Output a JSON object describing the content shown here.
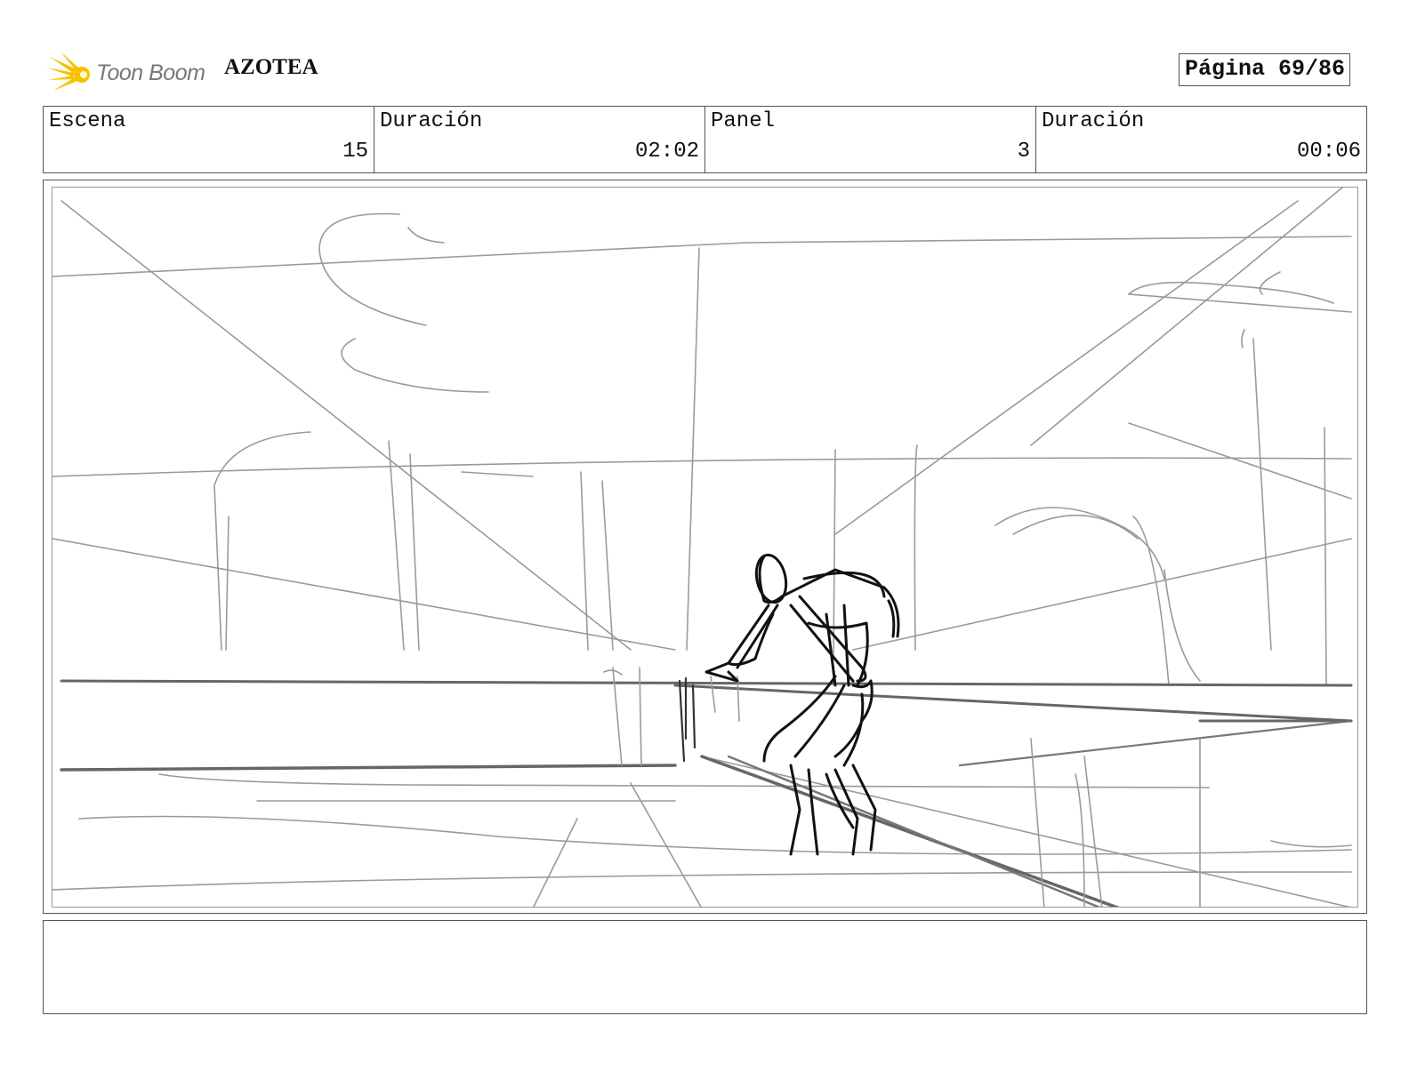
{
  "header": {
    "logo_text": "Toon Boom",
    "project_title": "AZOTEA",
    "page_label": "Página 69/86"
  },
  "info": {
    "scene_label": "Escena",
    "scene_value": "15",
    "scene_duration_label": "Duración",
    "scene_duration_value": "02:02",
    "panel_label": "Panel",
    "panel_value": "3",
    "panel_duration_label": "Duración",
    "panel_duration_value": "00:06"
  },
  "panel": {
    "sketch_icon": "storyboard-sketch-rooftop-figure"
  },
  "notes": {
    "text": ""
  },
  "colors": {
    "logo_yellow": "#f5c200",
    "logo_gray": "#777777",
    "border": "#555555",
    "sketch_light": "#9a9a9a",
    "sketch_dark": "#111111"
  }
}
